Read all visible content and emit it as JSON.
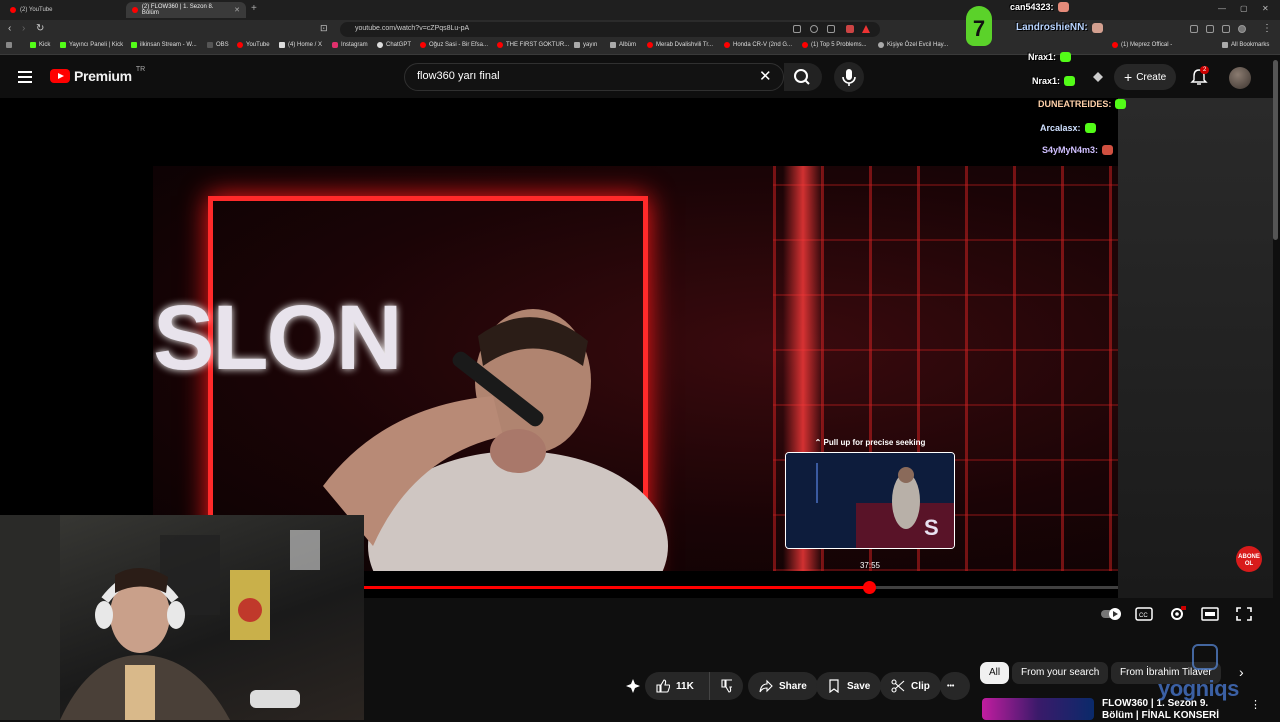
{
  "browser": {
    "tabs": [
      {
        "label": "(2) YouTube",
        "active": false
      },
      {
        "label": "(2) FLOW360 | 1. Sezon 8. Bölüm",
        "active": true
      }
    ],
    "new_tab_glyph": "+",
    "url": "youtube.com/watch?v=cZPqs8Lu-pA",
    "bookmarks": [
      {
        "label": "Kick",
        "color": "#53fc18"
      },
      {
        "label": "Yayıncı Paneli | Kick",
        "color": "#53fc18"
      },
      {
        "label": "ilkinsan Stream - W...",
        "color": "#53fc18"
      },
      {
        "label": "OBS",
        "color": "#555555"
      },
      {
        "label": "YouTube",
        "color": "#ff0000"
      },
      {
        "label": "(4) Home / X",
        "color": "#dddddd"
      },
      {
        "label": "Instagram",
        "color": "#e1306c"
      },
      {
        "label": "ChatGPT",
        "color": "#dddddd"
      },
      {
        "label": "Oğuz Sasi - Bir Efsa...",
        "color": "#ff0000"
      },
      {
        "label": "THE FIRST GOKTUR...",
        "color": "#ff0000"
      },
      {
        "label": "yayın",
        "color": "#aaaaaa"
      },
      {
        "label": "Albüm",
        "color": "#aaaaaa"
      },
      {
        "label": "Merab Dvalishvili Tr...",
        "color": "#ff0000"
      },
      {
        "label": "Honda CR-V (2nd G...",
        "color": "#ff0000"
      },
      {
        "label": "(1) Top 5 Problems...",
        "color": "#ff0000"
      },
      {
        "label": "Kişiye Özel Evcil Hay...",
        "color": "#aaaaaa"
      },
      {
        "label": "(1) Meprez Offical -",
        "color": "#ff0000"
      },
      {
        "label": "All Bookmarks",
        "color": "#aaaaaa"
      }
    ]
  },
  "youtube": {
    "logo_text": "Premium",
    "region": "TR",
    "search_value": "flow360 yarı final",
    "create_label": "Create",
    "notification_count": "2"
  },
  "video": {
    "banner_text": "SLON",
    "seek_hint": "⌃ Pull up for precise seeking",
    "preview_time": "37:55",
    "progress": 0.67,
    "accent": "#ff0000"
  },
  "actions": {
    "like_count": "11K",
    "share_label": "Share",
    "save_label": "Save",
    "clip_label": "Clip",
    "more_glyph": "•••"
  },
  "filter_chips": [
    {
      "label": "All",
      "active": true
    },
    {
      "label": "From your search",
      "active": false
    },
    {
      "label": "From İbrahim Tilaver",
      "active": false
    }
  ],
  "recommended": {
    "title": "FLOW360 | 1. Sezon 9. Bölüm | FİNAL KONSERİ"
  },
  "chat": [
    {
      "user": "can54323:",
      "color": "#ffffff",
      "emote": "#e58b7a"
    },
    {
      "user": "LandroshieNN:",
      "color": "#b8d4ff",
      "emote": "#d4a090"
    },
    {
      "user": "Nrax1:",
      "color": "#ffffff",
      "emote": "#53fc18"
    },
    {
      "user": "Nrax1:",
      "color": "#ffffff",
      "emote": "#53fc18"
    },
    {
      "user": "DUNEATREIDES:",
      "color": "#ffd0a8",
      "emote": "#53fc18"
    },
    {
      "user": "Arcalasx:",
      "color": "#ffffff",
      "emote": "#53fc18"
    },
    {
      "user": "S4yMyN4m3:",
      "color": "#d0c0ff",
      "emote": "#d05040"
    }
  ],
  "chat_badge_number": "7",
  "watermarks": {
    "subscribe": "ABONE OL",
    "brand": "yogniqs"
  }
}
